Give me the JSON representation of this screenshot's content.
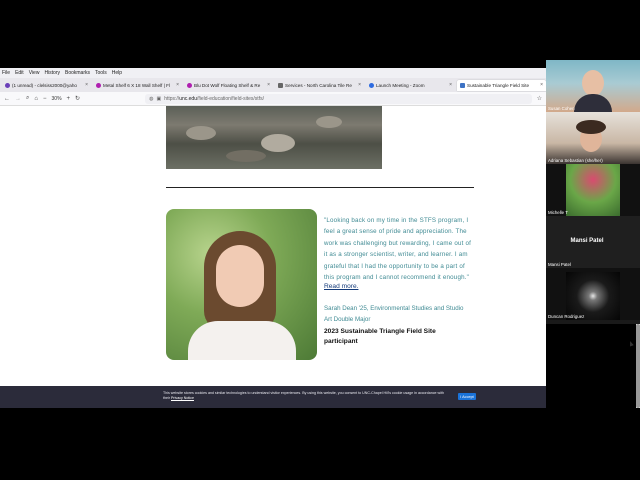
{
  "browser": {
    "menu": [
      "File",
      "Edit",
      "View",
      "History",
      "Bookmarks",
      "Tools",
      "Help"
    ],
    "tabs": [
      {
        "title": "(1 unread) - clelsiss2000@yaho",
        "color": "#6a3fb8",
        "active": false
      },
      {
        "title": "Metal Shelf 6 X 18 Wall Shelf | Fl",
        "color": "#b01fb0",
        "active": false
      },
      {
        "title": "Blu Dot Wolf Floating Shelf & Re",
        "color": "#b01fb0",
        "active": false
      },
      {
        "title": "Services - North Carolina Tile Re",
        "color": "#666666",
        "active": false
      },
      {
        "title": "Launch Meeting - Zoom",
        "color": "#2d6be0",
        "active": false
      },
      {
        "title": "Sustainable Triangle Field Site",
        "color": "#3d72c4",
        "active": true
      }
    ],
    "zoom": "30%",
    "url_prefix": "https://",
    "url_domain": "unc.edu",
    "url_path": "/field-education/field-sites/stfs/"
  },
  "page": {
    "quote": "\"Looking back on my time in the STFS program, I feel a great sense of pride and appreciation. The work was challenging but rewarding, I came out of it as a stronger scientist, writer, and learner. I am grateful that I had the opportunity to be a part of this program and I cannot recommend it enough.\"",
    "read_more": "Read more.",
    "author": "Sarah Dean '25, Environmental Studies and Studio Art Double Major",
    "program": "2023 Sustainable Triangle Field Site participant"
  },
  "cookie": {
    "text": "This website stores cookies and similar technologies to understand visitor experiences. By using this website, you consent to UNC-Chapel Hill's cookie usage in accordance with their",
    "link": "Privacy Notice",
    "accept": "I Accept"
  },
  "participants": [
    {
      "name": "Susan Cohen"
    },
    {
      "name": "Adriana Sebastian (she/her)"
    },
    {
      "name": "Michelle T"
    },
    {
      "name": "Mansi Patel",
      "display": "Mansi Patel"
    },
    {
      "name": "Duncan Rodriguez"
    }
  ]
}
